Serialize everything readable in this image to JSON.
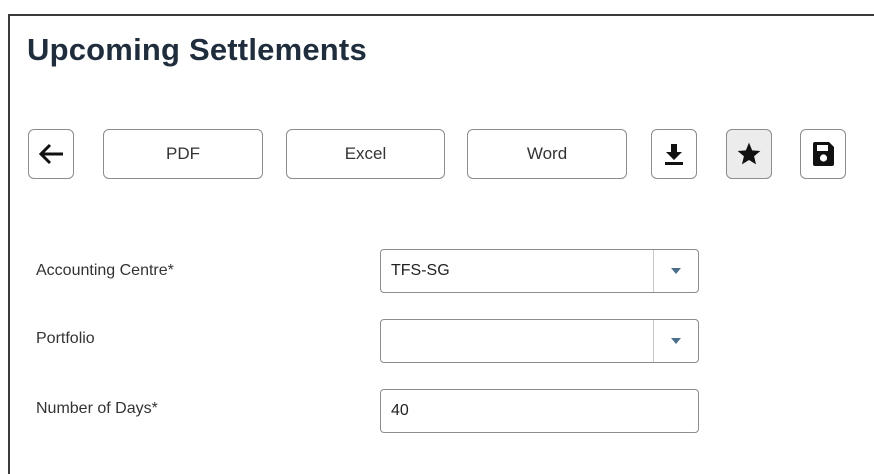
{
  "page": {
    "title": "Upcoming Settlements"
  },
  "toolbar": {
    "back_icon": "arrow-left-icon",
    "pdf_label": "PDF",
    "excel_label": "Excel",
    "word_label": "Word",
    "download_icon": "download-icon",
    "favorite_icon": "star-icon",
    "save_icon": "floppy-disk-icon"
  },
  "form": {
    "accounting_centre": {
      "label": "Accounting Centre*",
      "value": "TFS-SG"
    },
    "portfolio": {
      "label": "Portfolio",
      "value": ""
    },
    "number_of_days": {
      "label": "Number of Days*",
      "value": "40"
    }
  },
  "colors": {
    "title": "#1f2d3d",
    "border": "#8c8c8c",
    "dropdown_arrow": "#4a6f8a",
    "star_button_bg": "#ececec"
  }
}
